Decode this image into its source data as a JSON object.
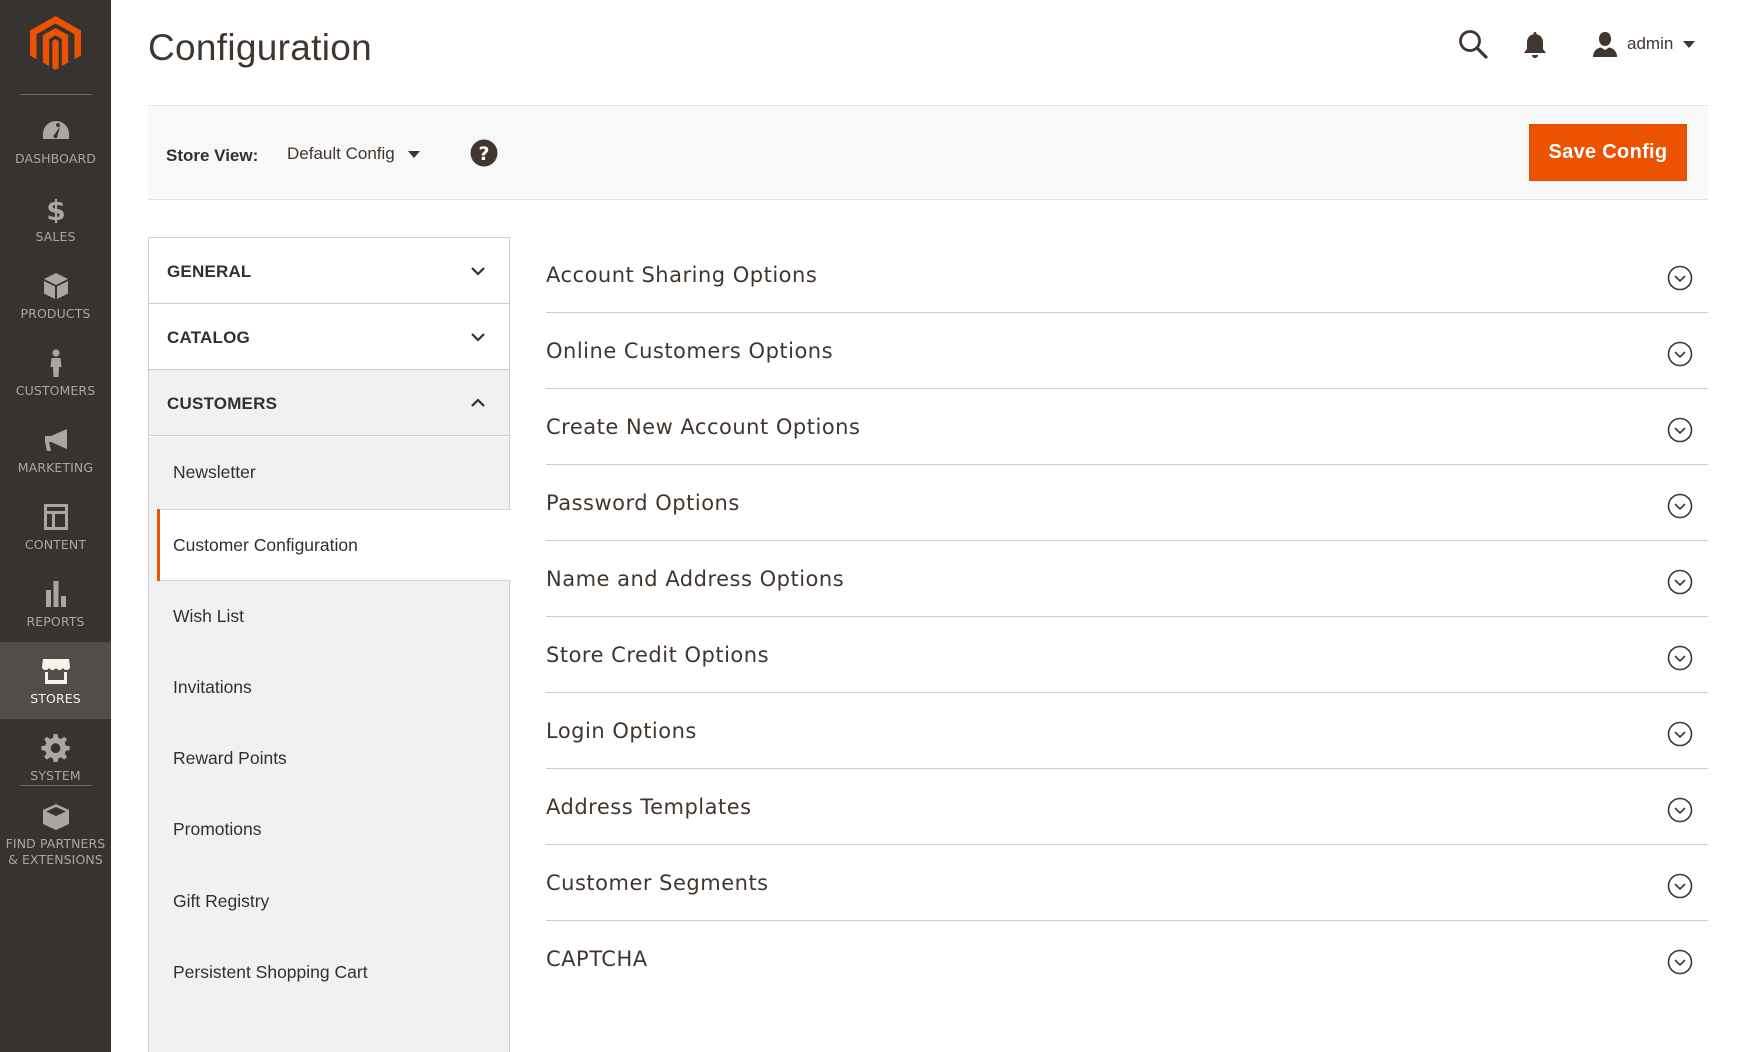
{
  "page": {
    "title": "Configuration"
  },
  "admin_menu": {
    "items": [
      {
        "label": "DASHBOARD",
        "icon": "dashboard-icon"
      },
      {
        "label": "SALES",
        "icon": "dollar-icon"
      },
      {
        "label": "PRODUCTS",
        "icon": "box-icon"
      },
      {
        "label": "CUSTOMERS",
        "icon": "person-icon"
      },
      {
        "label": "MARKETING",
        "icon": "megaphone-icon"
      },
      {
        "label": "CONTENT",
        "icon": "layout-icon"
      },
      {
        "label": "REPORTS",
        "icon": "bar-chart-icon"
      },
      {
        "label": "STORES",
        "icon": "storefront-icon",
        "active": true
      },
      {
        "label": "SYSTEM",
        "icon": "gear-icon"
      },
      {
        "label_line1": "FIND PARTNERS",
        "label_line2": "& EXTENSIONS",
        "icon": "blocks-icon"
      }
    ]
  },
  "header": {
    "user_name": "admin"
  },
  "store_view": {
    "label": "Store View:",
    "value": "Default Config"
  },
  "actions": {
    "save_label": "Save Config"
  },
  "colors": {
    "accent": "#eb5202",
    "menu_bg": "#373330",
    "menu_active": "#524d49"
  },
  "config_nav": {
    "tabs": [
      {
        "label": "GENERAL",
        "state": "collapsed"
      },
      {
        "label": "CATALOG",
        "state": "collapsed"
      },
      {
        "label": "CUSTOMERS",
        "state": "expanded"
      }
    ],
    "customers_items": [
      {
        "label": "Newsletter"
      },
      {
        "label": "Customer Configuration",
        "active": true
      },
      {
        "label": "Wish List"
      },
      {
        "label": "Invitations"
      },
      {
        "label": "Reward Points"
      },
      {
        "label": "Promotions"
      },
      {
        "label": "Gift Registry"
      },
      {
        "label": "Persistent Shopping Cart"
      }
    ]
  },
  "sections": [
    {
      "title": "Account Sharing Options"
    },
    {
      "title": "Online Customers Options"
    },
    {
      "title": "Create New Account Options"
    },
    {
      "title": "Password Options"
    },
    {
      "title": "Name and Address Options"
    },
    {
      "title": "Store Credit Options"
    },
    {
      "title": "Login Options"
    },
    {
      "title": "Address Templates"
    },
    {
      "title": "Customer Segments"
    },
    {
      "title": "CAPTCHA"
    }
  ]
}
